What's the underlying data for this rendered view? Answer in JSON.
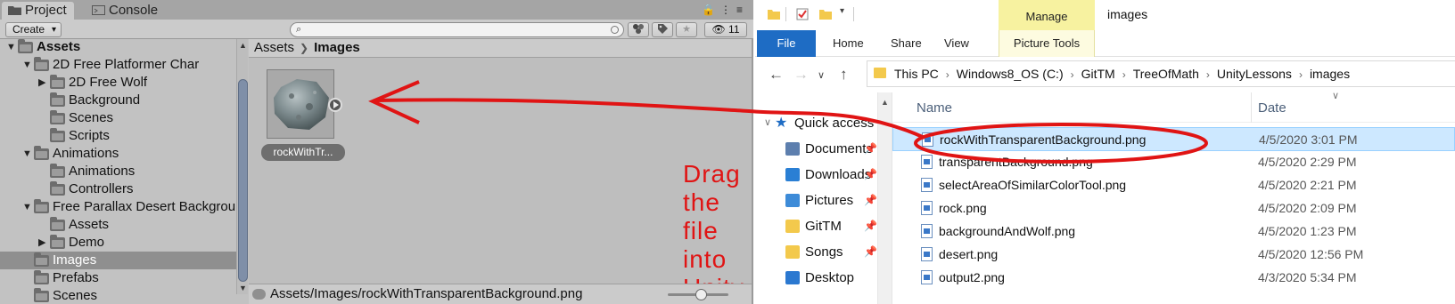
{
  "unity": {
    "tabs": [
      {
        "label": "Project",
        "icon": "folder-icon"
      },
      {
        "label": "Console",
        "icon": "console-icon"
      }
    ],
    "toolbar": {
      "create_label": "Create",
      "search_placeholder": "",
      "hidden_count": "11"
    },
    "tree": [
      {
        "label": "Assets",
        "depth": 0,
        "expanded": true,
        "root": true
      },
      {
        "label": "2D Free Platformer Char",
        "depth": 1,
        "expanded": true
      },
      {
        "label": "2D Free Wolf",
        "depth": 2,
        "expanded": false
      },
      {
        "label": "Background",
        "depth": 2
      },
      {
        "label": "Scenes",
        "depth": 2
      },
      {
        "label": "Scripts",
        "depth": 2
      },
      {
        "label": "Animations",
        "depth": 1,
        "expanded": true
      },
      {
        "label": "Animations",
        "depth": 2
      },
      {
        "label": "Controllers",
        "depth": 2
      },
      {
        "label": "Free Parallax Desert Backgrou",
        "depth": 1,
        "expanded": true
      },
      {
        "label": "Assets",
        "depth": 2
      },
      {
        "label": "Demo",
        "depth": 2,
        "expanded": false
      },
      {
        "label": "Images",
        "depth": 1,
        "selected": true
      },
      {
        "label": "Prefabs",
        "depth": 1
      },
      {
        "label": "Scenes",
        "depth": 1
      }
    ],
    "breadcrumb": {
      "root": "Assets",
      "current": "Images"
    },
    "asset": {
      "label": "rockWithTr..."
    },
    "status_path": "Assets/Images/rockWithTransparentBackground.png",
    "annotation": "Drag the file into Unity",
    "annotation_color": "#e01414"
  },
  "explorer": {
    "ribbon_context_tab": "Manage",
    "window_title": "images",
    "ribbon_tabs": {
      "file": "File",
      "home": "Home",
      "share": "Share",
      "view": "View",
      "picture_tools": "Picture Tools"
    },
    "address": [
      "This PC",
      "Windows8_OS (C:)",
      "GitTM",
      "TreeOfMath",
      "UnityLessons",
      "images"
    ],
    "nav_items": [
      {
        "label": "Quick access",
        "icon": "star-icon",
        "pinned": false
      },
      {
        "label": "Documents",
        "icon": "documents-icon",
        "pinned": true
      },
      {
        "label": "Downloads",
        "icon": "downloads-icon",
        "pinned": true
      },
      {
        "label": "Pictures",
        "icon": "pictures-icon",
        "pinned": true
      },
      {
        "label": "GitTM",
        "icon": "folder-icon",
        "pinned": true
      },
      {
        "label": "Songs",
        "icon": "folder-icon",
        "pinned": true
      },
      {
        "label": "Desktop",
        "icon": "desktop-icon",
        "pinned": false
      }
    ],
    "columns": {
      "name": "Name",
      "date": "Date"
    },
    "files": [
      {
        "name": "rockWithTransparentBackground.png",
        "date": "4/5/2020 3:01 PM",
        "selected": true
      },
      {
        "name": "transparentBackground.png",
        "date": "4/5/2020 2:29 PM"
      },
      {
        "name": "selectAreaOfSimilarColorTool.png",
        "date": "4/5/2020 2:21 PM"
      },
      {
        "name": "rock.png",
        "date": "4/5/2020 2:09 PM"
      },
      {
        "name": "backgroundAndWolf.png",
        "date": "4/5/2020 1:23 PM"
      },
      {
        "name": "desert.png",
        "date": "4/5/2020 12:56 PM"
      },
      {
        "name": "output2.png",
        "date": "4/3/2020 5:34 PM"
      }
    ],
    "accent_color": "#1e6cc4"
  }
}
